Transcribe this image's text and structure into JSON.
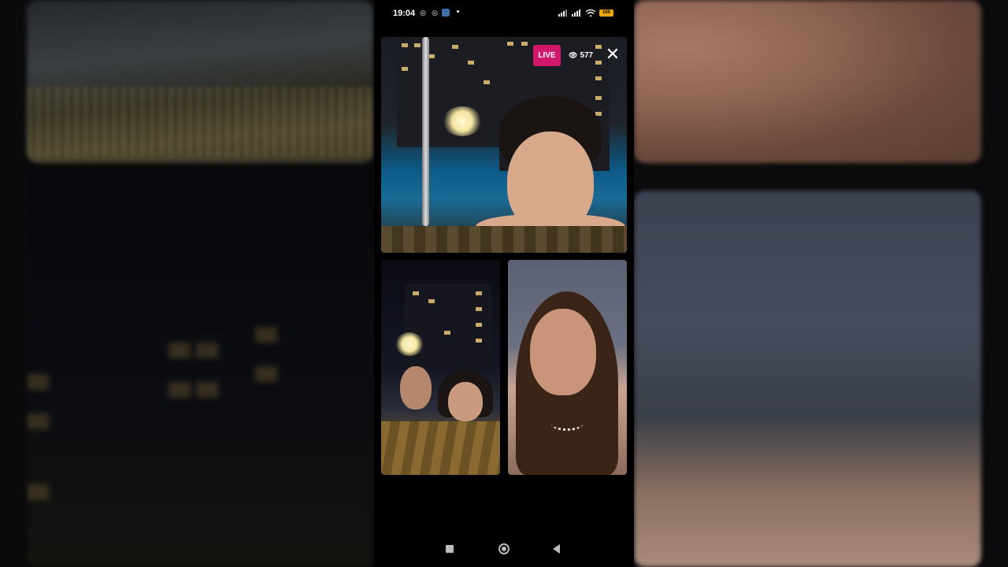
{
  "status_bar": {
    "time": "19:04",
    "battery": "100",
    "icons": [
      "instagram-icon",
      "instagram-icon",
      "app-icon",
      "signal-icon",
      "signal-icon",
      "wifi-icon",
      "battery-icon"
    ]
  },
  "live": {
    "badge": "LIVE",
    "viewer_count": "577",
    "viewer_icon": "eye-icon",
    "close_icon": "close-icon",
    "badge_color": "#d1186a"
  },
  "participants": [
    {
      "role": "host",
      "scene": "pool-at-night"
    },
    {
      "role": "guest",
      "scene": "two-people-outdoors-night"
    },
    {
      "role": "guest",
      "scene": "woman-indoors"
    }
  ],
  "nav_bar": {
    "icons": [
      "recent-apps-icon",
      "home-icon",
      "back-icon"
    ]
  }
}
